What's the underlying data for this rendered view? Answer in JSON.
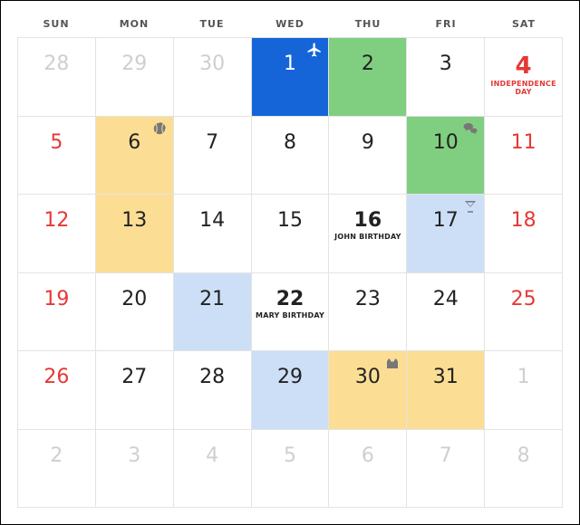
{
  "day_headers": [
    "SUN",
    "MON",
    "TUE",
    "WED",
    "THU",
    "FRI",
    "SAT"
  ],
  "icons": {
    "airplane": "airplane-icon",
    "ball": "ball-icon",
    "chat": "chat-icon",
    "cocktail": "cocktail-icon",
    "box": "box-icon"
  },
  "colors": {
    "weekend": "#e53935",
    "outside": "#cfcfcf",
    "blue": "#1565d8",
    "green": "#80cf80",
    "lblue": "#cddff7",
    "yellow": "#fbde94"
  },
  "weeks": [
    [
      {
        "num": "28",
        "classes": "outside"
      },
      {
        "num": "29",
        "classes": "outside"
      },
      {
        "num": "30",
        "classes": "outside"
      },
      {
        "num": "1",
        "classes": "blue",
        "icon": "airplane"
      },
      {
        "num": "2",
        "classes": "green"
      },
      {
        "num": "3",
        "classes": ""
      },
      {
        "num": "4",
        "classes": "holiday",
        "sub": "INDEPENDENCE DAY"
      }
    ],
    [
      {
        "num": "5",
        "classes": "weekend"
      },
      {
        "num": "6",
        "classes": "yellow",
        "icon": "ball"
      },
      {
        "num": "7",
        "classes": ""
      },
      {
        "num": "8",
        "classes": ""
      },
      {
        "num": "9",
        "classes": ""
      },
      {
        "num": "10",
        "classes": "green",
        "icon": "chat"
      },
      {
        "num": "11",
        "classes": "weekend"
      }
    ],
    [
      {
        "num": "12",
        "classes": "weekend"
      },
      {
        "num": "13",
        "classes": "yellow"
      },
      {
        "num": "14",
        "classes": ""
      },
      {
        "num": "15",
        "classes": ""
      },
      {
        "num": "16",
        "classes": "bold",
        "sub": "JOHN BIRTHDAY"
      },
      {
        "num": "17",
        "classes": "lblue",
        "icon": "cocktail"
      },
      {
        "num": "18",
        "classes": "weekend"
      }
    ],
    [
      {
        "num": "19",
        "classes": "weekend"
      },
      {
        "num": "20",
        "classes": ""
      },
      {
        "num": "21",
        "classes": "lblue"
      },
      {
        "num": "22",
        "classes": "bold",
        "sub": "MARY BIRTHDAY"
      },
      {
        "num": "23",
        "classes": ""
      },
      {
        "num": "24",
        "classes": ""
      },
      {
        "num": "25",
        "classes": "weekend"
      }
    ],
    [
      {
        "num": "26",
        "classes": "weekend"
      },
      {
        "num": "27",
        "classes": ""
      },
      {
        "num": "28",
        "classes": ""
      },
      {
        "num": "29",
        "classes": "lblue"
      },
      {
        "num": "30",
        "classes": "yellow",
        "icon": "box"
      },
      {
        "num": "31",
        "classes": "yellow"
      },
      {
        "num": "1",
        "classes": "outside"
      }
    ],
    [
      {
        "num": "2",
        "classes": "outside"
      },
      {
        "num": "3",
        "classes": "outside"
      },
      {
        "num": "4",
        "classes": "outside"
      },
      {
        "num": "5",
        "classes": "outside"
      },
      {
        "num": "6",
        "classes": "outside"
      },
      {
        "num": "7",
        "classes": "outside"
      },
      {
        "num": "8",
        "classes": "outside"
      }
    ]
  ]
}
